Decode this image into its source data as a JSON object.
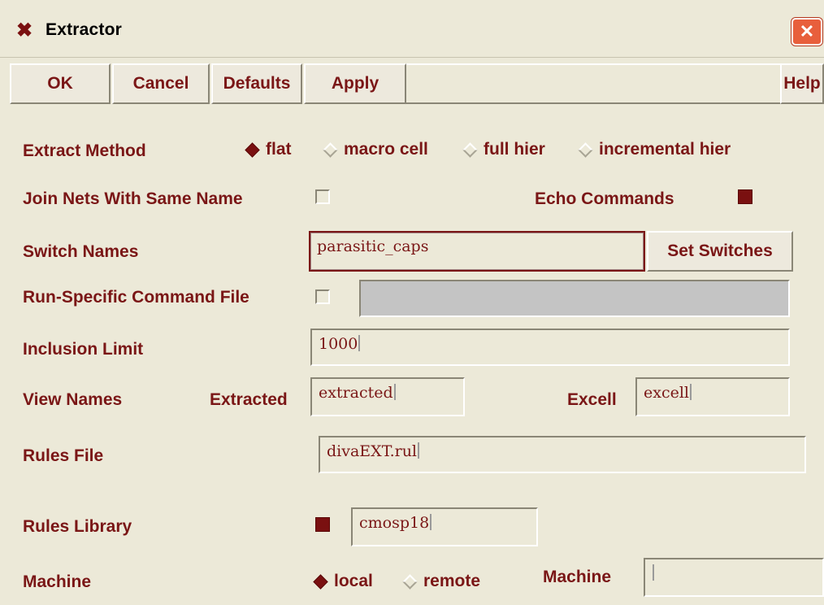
{
  "window": {
    "title": "Extractor",
    "title_icon": "x-logo-icon",
    "close_icon": "close-icon"
  },
  "toolbar": {
    "ok": "OK",
    "cancel": "Cancel",
    "defaults": "Defaults",
    "apply": "Apply",
    "help": "Help"
  },
  "extract_method": {
    "label": "Extract Method",
    "options": [
      {
        "label": "flat",
        "selected": true
      },
      {
        "label": "macro cell",
        "selected": false
      },
      {
        "label": "full hier",
        "selected": false
      },
      {
        "label": "incremental hier",
        "selected": false
      }
    ]
  },
  "join_nets": {
    "label": "Join Nets With Same Name",
    "checked": false
  },
  "echo_commands": {
    "label": "Echo Commands",
    "checked": true
  },
  "switch_names": {
    "label": "Switch Names",
    "value": "parasitic_caps",
    "button": "Set Switches"
  },
  "run_specific": {
    "label": "Run-Specific Command File",
    "checked": false,
    "value": ""
  },
  "inclusion_limit": {
    "label": "Inclusion Limit",
    "value": "1000"
  },
  "view_names": {
    "label": "View Names",
    "extracted_label": "Extracted",
    "extracted_value": "extracted",
    "excell_label": "Excell",
    "excell_value": "excell"
  },
  "rules_file": {
    "label": "Rules File",
    "value": "divaEXT.rul"
  },
  "rules_library": {
    "label": "Rules Library",
    "checked": true,
    "value": "cmosp18"
  },
  "machine": {
    "label": "Machine",
    "options": [
      {
        "label": "local",
        "selected": true
      },
      {
        "label": "remote",
        "selected": false
      }
    ],
    "field_label": "Machine",
    "field_value": ""
  },
  "colors": {
    "accent": "#7a1616",
    "background": "#ece9d8",
    "close": "#e85f3c"
  }
}
